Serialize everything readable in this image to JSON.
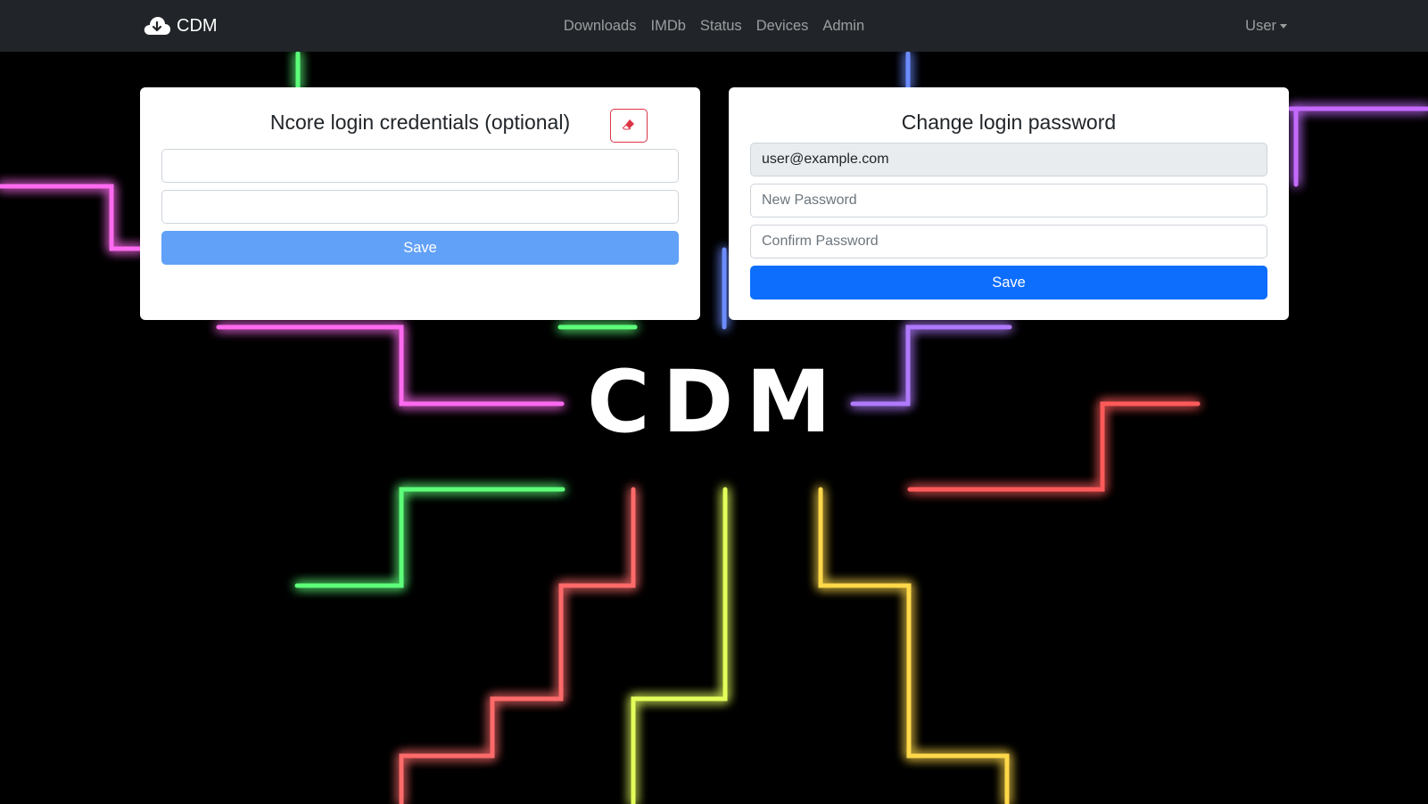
{
  "navbar": {
    "brand": "CDM",
    "links": [
      "Downloads",
      "IMDb",
      "Status",
      "Devices",
      "Admin"
    ],
    "user_menu": "User"
  },
  "ncore_card": {
    "title": "Ncore login credentials (optional)",
    "username_value": "",
    "password_value": "",
    "save_label": "Save",
    "erase_icon": "eraser-icon"
  },
  "password_card": {
    "title": "Change login password",
    "email_value": "user@example.com",
    "new_password_placeholder": "New Password",
    "confirm_password_placeholder": "Confirm Password",
    "save_label": "Save"
  },
  "background": {
    "logo_text": "CDM"
  },
  "colors": {
    "navbar_bg": "#212529",
    "primary": "#0d6efd",
    "primary_disabled": "#62a1f8",
    "danger": "#dc3545"
  }
}
